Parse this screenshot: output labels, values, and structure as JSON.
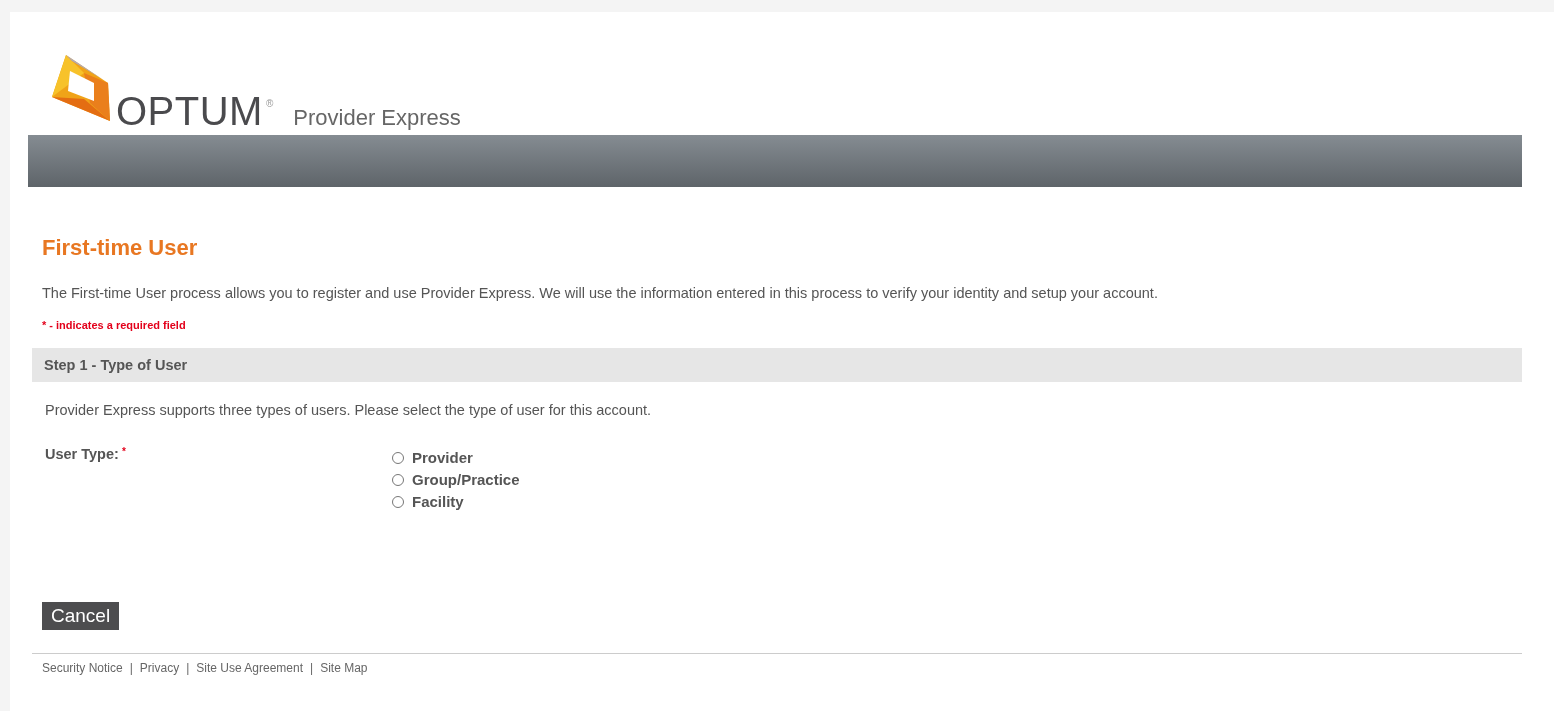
{
  "header": {
    "brand": "OPTUM",
    "trademark": "®",
    "product": "Provider Express"
  },
  "page": {
    "title": "First-time User",
    "intro": "The First-time User process allows you to register and use Provider Express. We will use the information entered in this process to verify your identity and setup your account.",
    "required_note": "* - indicates a required field"
  },
  "step": {
    "title": "Step 1 - Type of User",
    "description": "Provider Express supports three types of users. Please select the type of user for this account.",
    "field_label": "User Type:",
    "required_mark": "*",
    "options": [
      {
        "label": "Provider",
        "selected": false
      },
      {
        "label": "Group/Practice",
        "selected": false
      },
      {
        "label": "Facility",
        "selected": false
      }
    ]
  },
  "buttons": {
    "cancel": "Cancel"
  },
  "footer": {
    "separator": "|",
    "links": [
      "Security Notice",
      "Privacy",
      "Site Use Agreement",
      "Site Map"
    ]
  }
}
